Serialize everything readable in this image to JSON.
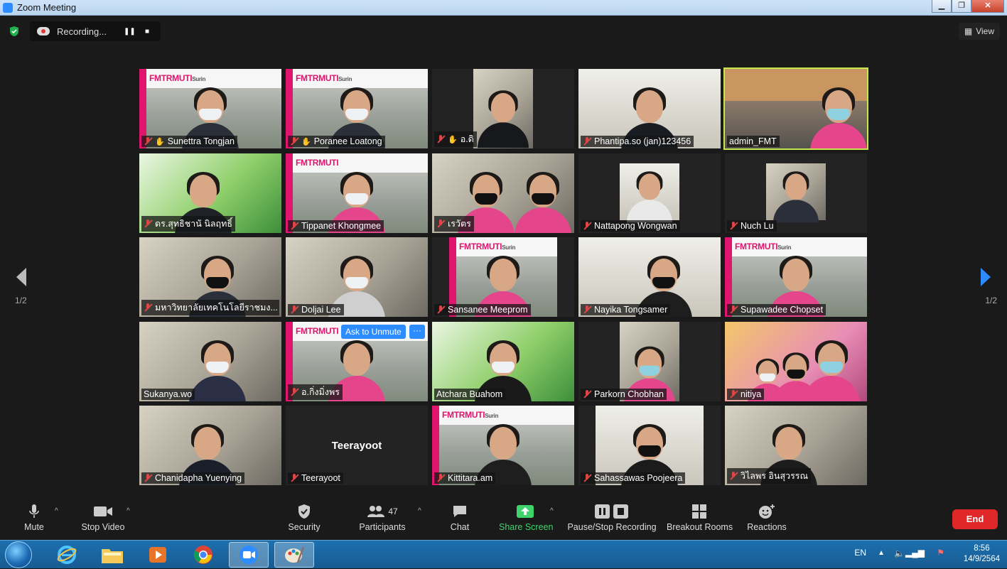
{
  "window": {
    "title": "Zoom Meeting"
  },
  "recording": {
    "label": "Recording..."
  },
  "view_button": {
    "label": "View"
  },
  "pages": {
    "left": "1/2",
    "right": "1/2"
  },
  "participants": [
    {
      "name": "Sunettra Tongjan",
      "hand": true
    },
    {
      "name": "Poranee Loatong",
      "hand": true
    },
    {
      "name": "อ.ดิ",
      "hand": true
    },
    {
      "name": "Phantipa.so (jan)123456",
      "hand": false
    },
    {
      "name": "admin_FMT",
      "hand": false
    },
    {
      "name": "ดร.สุทธิชานั นิลฤทธิ์",
      "hand": false
    },
    {
      "name": "Tippanet Khongmee",
      "hand": false
    },
    {
      "name": "เรวัตร",
      "hand": false
    },
    {
      "name": "Nattapong Wongwan",
      "hand": false
    },
    {
      "name": "Nuch Lu",
      "hand": false
    },
    {
      "name": "มหาวิทยาลัยเทคโนโลยีราชมง...",
      "hand": false
    },
    {
      "name": "Doljai Lee",
      "hand": false
    },
    {
      "name": "Sansanee Meeprom",
      "hand": false
    },
    {
      "name": "Nayika Tongsamer",
      "hand": false
    },
    {
      "name": "Supawadee Chopset",
      "hand": false
    },
    {
      "name": "Sukanya.wo",
      "hand": false
    },
    {
      "name": "อ.กิ่งมิ่งพร",
      "hand": false
    },
    {
      "name": "Atchara Buahom",
      "hand": false
    },
    {
      "name": "Parkorn Chobhan",
      "hand": false
    },
    {
      "name": "nitiya",
      "hand": false
    },
    {
      "name": "Chanidapha Yuenying",
      "hand": false
    },
    {
      "name": "Teerayoot",
      "hand": false
    },
    {
      "name": "Kittitara.am",
      "hand": false
    },
    {
      "name": "Sahassawas Poojeera",
      "hand": false
    },
    {
      "name": "วิไลพร อินสุวรรณ",
      "hand": false
    }
  ],
  "tile_overlay": {
    "ask_to_unmute": "Ask to Unmute",
    "more": "···",
    "big_name": "Teerayoot"
  },
  "fmt_logo": {
    "main": "FMTRMUTI",
    "sub": "Surin"
  },
  "toolbar": {
    "mute": "Mute",
    "stop_video": "Stop Video",
    "security": "Security",
    "participants": "Participants",
    "participants_count": "47",
    "chat": "Chat",
    "share_screen": "Share Screen",
    "recording": "Pause/Stop Recording",
    "breakout": "Breakout Rooms",
    "reactions": "Reactions",
    "end": "End"
  },
  "taskbar": {
    "lang": "EN",
    "time": "8:56",
    "date": "14/9/2564"
  },
  "colors": {
    "accent": "#2d8cff",
    "end_red": "#e02828",
    "share_green": "#3fd36b",
    "active_speaker": "#c5e84a",
    "muted_red": "#e04545"
  }
}
